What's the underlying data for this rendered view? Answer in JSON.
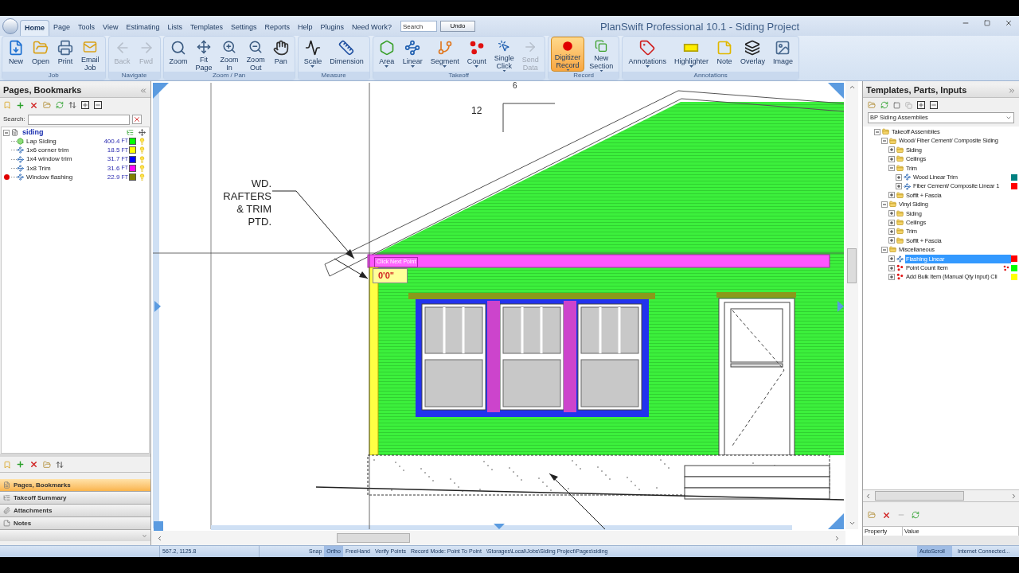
{
  "window": {
    "title": "PlanSwift Professional 10.1 - Siding Project"
  },
  "tabs": [
    {
      "label": "Home",
      "selected": true
    },
    {
      "label": "Page",
      "selected": false
    },
    {
      "label": "Tools",
      "selected": false
    },
    {
      "label": "View",
      "selected": false
    },
    {
      "label": "Estimating",
      "selected": false
    },
    {
      "label": "Lists",
      "selected": false
    },
    {
      "label": "Templates",
      "selected": false
    },
    {
      "label": "Settings",
      "selected": false
    },
    {
      "label": "Reports",
      "selected": false
    },
    {
      "label": "Help",
      "selected": false
    },
    {
      "label": "Plugins",
      "selected": false
    },
    {
      "label": "Need Work?",
      "selected": false
    }
  ],
  "search": {
    "placeholder": "Search"
  },
  "undo_button": "Undo",
  "ribbon": [
    {
      "label": "Job",
      "buttons": [
        {
          "lines": [
            "New"
          ],
          "disabled": false,
          "active": false,
          "dropdown": false
        },
        {
          "lines": [
            "Open"
          ],
          "disabled": false,
          "active": false,
          "dropdown": false
        },
        {
          "lines": [
            "Print"
          ],
          "disabled": false,
          "active": false,
          "dropdown": false
        },
        {
          "lines": [
            "Email",
            "Job"
          ],
          "disabled": false,
          "active": false,
          "dropdown": false
        }
      ]
    },
    {
      "label": "Navigate",
      "buttons": [
        {
          "lines": [
            "Back"
          ],
          "disabled": true,
          "active": false,
          "dropdown": false
        },
        {
          "lines": [
            "Fwd"
          ],
          "disabled": true,
          "active": false,
          "dropdown": false
        }
      ]
    },
    {
      "label": "Zoom / Pan",
      "buttons": [
        {
          "lines": [
            "Zoom"
          ],
          "disabled": false,
          "active": false,
          "dropdown": false
        },
        {
          "lines": [
            "Fit",
            "Page"
          ],
          "disabled": false,
          "active": false,
          "dropdown": false
        },
        {
          "lines": [
            "Zoom",
            "In"
          ],
          "disabled": false,
          "active": false,
          "dropdown": false
        },
        {
          "lines": [
            "Zoom",
            "Out"
          ],
          "disabled": false,
          "active": false,
          "dropdown": false
        },
        {
          "lines": [
            "Pan"
          ],
          "disabled": false,
          "active": false,
          "dropdown": false
        }
      ]
    },
    {
      "label": "Measure",
      "buttons": [
        {
          "lines": [
            "Scale"
          ],
          "disabled": false,
          "active": false,
          "dropdown": true
        },
        {
          "lines": [
            "Dimension"
          ],
          "disabled": false,
          "active": false,
          "dropdown": false
        }
      ]
    },
    {
      "label": "Takeoff",
      "buttons": [
        {
          "lines": [
            "Area"
          ],
          "disabled": false,
          "active": false,
          "dropdown": true
        },
        {
          "lines": [
            "Linear"
          ],
          "disabled": false,
          "active": false,
          "dropdown": true
        },
        {
          "lines": [
            "Segment"
          ],
          "disabled": false,
          "active": false,
          "dropdown": true
        },
        {
          "lines": [
            "Count"
          ],
          "disabled": false,
          "active": false,
          "dropdown": true
        },
        {
          "lines": [
            "Single",
            "Click"
          ],
          "disabled": false,
          "active": false,
          "dropdown": true
        },
        {
          "lines": [
            "Send",
            "Data"
          ],
          "disabled": true,
          "active": false,
          "dropdown": false
        }
      ]
    },
    {
      "label": "Record",
      "buttons": [
        {
          "lines": [
            "Digitizer",
            "Record"
          ],
          "disabled": false,
          "active": true,
          "dropdown": true
        },
        {
          "lines": [
            "New",
            "Section"
          ],
          "disabled": false,
          "active": false,
          "dropdown": true
        }
      ]
    },
    {
      "label": "Annotations",
      "buttons": [
        {
          "lines": [
            "Annotations"
          ],
          "disabled": false,
          "active": false,
          "dropdown": true
        },
        {
          "lines": [
            "Highlighter"
          ],
          "disabled": false,
          "active": false,
          "dropdown": true
        },
        {
          "lines": [
            "Note"
          ],
          "disabled": false,
          "active": false,
          "dropdown": false
        },
        {
          "lines": [
            "Overlay"
          ],
          "disabled": false,
          "active": false,
          "dropdown": false
        },
        {
          "lines": [
            "Image"
          ],
          "disabled": false,
          "active": false,
          "dropdown": false
        }
      ]
    }
  ],
  "left_panel": {
    "title": "Pages, Bookmarks",
    "search_label": "Search:",
    "page": {
      "name": "siding",
      "expanded": true,
      "items": [
        {
          "kind": "area",
          "name": "Lap Siding",
          "value": "400.4",
          "unit": "FT",
          "color": "#00ff00",
          "recording": false
        },
        {
          "kind": "linear",
          "name": "1x6 corner trim",
          "value": "18.5",
          "unit": "FT",
          "color": "#ffff00",
          "recording": false
        },
        {
          "kind": "linear",
          "name": "1x4 window trim",
          "value": "31.7",
          "unit": "FT",
          "color": "#0000ff",
          "recording": false
        },
        {
          "kind": "linear",
          "name": "1x8 Trim",
          "value": "31.6",
          "unit": "FT",
          "color": "#ff00ff",
          "recording": false
        },
        {
          "kind": "linear",
          "name": "Window flashing",
          "value": "22.9",
          "unit": "FT",
          "color": "#808000",
          "recording": true
        }
      ]
    },
    "nav": [
      {
        "label": "Pages, Bookmarks",
        "selected": true
      },
      {
        "label": "Takeoff Summary",
        "selected": false
      },
      {
        "label": "Attachments",
        "selected": false
      },
      {
        "label": "Notes",
        "selected": false
      }
    ]
  },
  "drawing": {
    "cut_label": "6",
    "slope_label": "12",
    "note_lines": [
      "WD.",
      "RAFTERS",
      "& TRIM",
      "PTD."
    ],
    "tooltip": "Click Next Point",
    "measurement": "0'0\""
  },
  "right_panel": {
    "title": "Templates, Parts, Inputs",
    "template_select": "BP Siding Assemblies",
    "tree": [
      {
        "kind": "folder",
        "name": "Takeoff Assemblies",
        "expanded": true,
        "selected": false,
        "children": [
          {
            "kind": "folder",
            "name": "Wood/ Fiber Cement/ Composite Siding",
            "expanded": true,
            "selected": false,
            "children": [
              {
                "kind": "folder",
                "name": "Siding",
                "expanded": false,
                "selected": false
              },
              {
                "kind": "folder",
                "name": "Ceilings",
                "expanded": false,
                "selected": false
              },
              {
                "kind": "folder",
                "name": "Trim",
                "expanded": true,
                "selected": false,
                "children": [
                  {
                    "kind": "linear",
                    "name": "Wood Linear Trim",
                    "expanded": false,
                    "selected": false,
                    "color": "#008080"
                  },
                  {
                    "kind": "linear",
                    "name": "Fiber Cement/ Composite Linear 1",
                    "expanded": false,
                    "selected": false,
                    "color": "#ff0000"
                  }
                ]
              },
              {
                "kind": "folder",
                "name": "Soffit + Fascia",
                "expanded": false,
                "selected": false
              }
            ]
          },
          {
            "kind": "folder",
            "name": "Vinyl Siding",
            "expanded": true,
            "selected": false,
            "children": [
              {
                "kind": "folder",
                "name": "Siding",
                "expanded": false,
                "selected": false
              },
              {
                "kind": "folder",
                "name": "Ceilings",
                "expanded": false,
                "selected": false
              },
              {
                "kind": "folder",
                "name": "Trim",
                "expanded": false,
                "selected": false
              },
              {
                "kind": "folder",
                "name": "Soffit + Fascia",
                "expanded": false,
                "selected": false
              }
            ]
          },
          {
            "kind": "folder",
            "name": "Miscellaneous",
            "expanded": true,
            "selected": false,
            "children": [
              {
                "kind": "linear",
                "name": "Flashing Linear",
                "expanded": false,
                "selected": true,
                "color": "#ff0000"
              },
              {
                "kind": "count",
                "name": "Point Count Item",
                "expanded": false,
                "selected": false,
                "color": "#00ff00",
                "count_marker": true
              },
              {
                "kind": "count",
                "name": "Add Bulk Item (Manual Qty Input) Cli",
                "expanded": false,
                "selected": false,
                "color": "#ffff00",
                "count_marker": false
              }
            ]
          }
        ]
      }
    ],
    "columns": [
      "Property",
      "Value"
    ]
  },
  "status_bar": {
    "coordinates": "567.2, 1125.8",
    "toggles": [
      {
        "label": "Snap",
        "on": false
      },
      {
        "label": "Ortho",
        "on": true
      },
      {
        "label": "FreeHand",
        "on": false
      },
      {
        "label": "Verify Points",
        "on": false
      }
    ],
    "record_mode": "Record Mode: Point To Point",
    "path": "\\Storages\\Local\\Jobs\\Siding Project\\Pages\\siding",
    "autoscroll": {
      "label": "AutoScroll",
      "on": true
    },
    "connection": "Internet Connected..."
  }
}
